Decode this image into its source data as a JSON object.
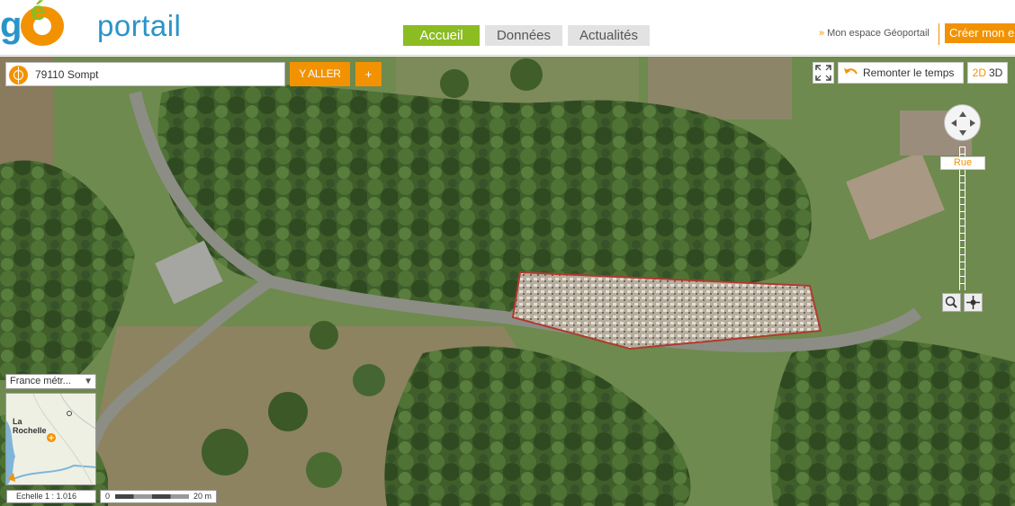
{
  "header": {
    "logo_geo": "g",
    "logo_e": "é",
    "logo_portail": "portail",
    "nav_tabs": [
      {
        "label": "Accueil",
        "active": true
      },
      {
        "label": "Données",
        "active": false
      },
      {
        "label": "Actualités",
        "active": false
      }
    ],
    "espace_link": "Mon espace Géoportail",
    "creer_button": "Créer mon es"
  },
  "search": {
    "value": "79110 Sompt",
    "go_label": "Y ALLER",
    "plus_label": "+"
  },
  "tools": {
    "remonter_label": "Remonter le temps",
    "mode_2d": "2D",
    "mode_3d": "3D",
    "zoom_level_label": "Rue"
  },
  "overview": {
    "territory": "France métr...",
    "city_label": "La\nRochelle"
  },
  "scale": {
    "text": "Echelle 1 :  1.016",
    "bar_zero": "0",
    "bar_distance": "20 m"
  },
  "colors": {
    "accent": "#f39200",
    "active_tab": "#8bbc21",
    "logo_blue": "#2a94c9"
  }
}
